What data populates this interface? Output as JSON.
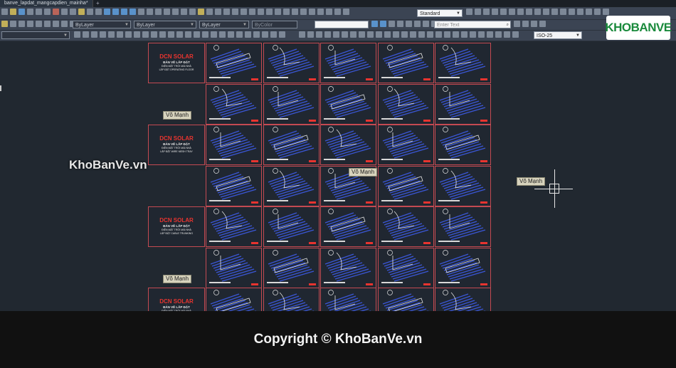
{
  "file_tab": {
    "label": "banve_lapdat_mangcapdien_mainha*",
    "add_label": "+"
  },
  "toolbar": {
    "text_style": "Standard",
    "layer": "ByLayer",
    "linetype": "ByLayer",
    "lineweight": "ByLayer",
    "plot_color": "ByColor",
    "search_placeholder": "Enter Text",
    "dim_style": "ISO-25"
  },
  "watermark_logo": "KHOBANVE",
  "title_blocks": [
    {
      "logo": "DCN SOLAR",
      "line1": "BẢN VẼ LẮP ĐẶT",
      "line2": "ĐIỆN MẶT TRỜI MÁI NHÀ",
      "line3": "LẮP ĐẶT OPERATING FLOOR"
    },
    {
      "logo": "DCN SOLAR",
      "line1": "BẢN VẼ LẮP ĐẶT",
      "line2": "ĐIỆN MẶT TRỜI MÁI NHÀ",
      "line3": "LẮP ĐẶT WIRE MESH TRAY"
    },
    {
      "logo": "DCN SOLAR",
      "line1": "BẢN VẼ LẮP ĐẶT",
      "line2": "ĐIỆN MẶT TRỜI MÁI NHÀ",
      "line3": "LẮP ĐẶT CABLE TRUNKING"
    },
    {
      "logo": "DCN SOLAR",
      "line1": "BẢN VẼ LẮP ĐẶT",
      "line2": "ĐIỆN MẶT TRỜI MÁI NHÀ",
      "line3": ""
    }
  ],
  "tags": {
    "tag1": "Võ Mạnh",
    "tag2": "Võ Mạnh",
    "tag3": "Võ Mạnh",
    "tag4": "Võ Mạnh"
  },
  "watermark_text": "KhoBanVe.vn",
  "footer": "Copyright © KhoBanVe.vn",
  "colors": {
    "background": "#212830",
    "frame": "#c44a52",
    "roof": "#3a56d6",
    "brand_red": "#e8342f"
  }
}
